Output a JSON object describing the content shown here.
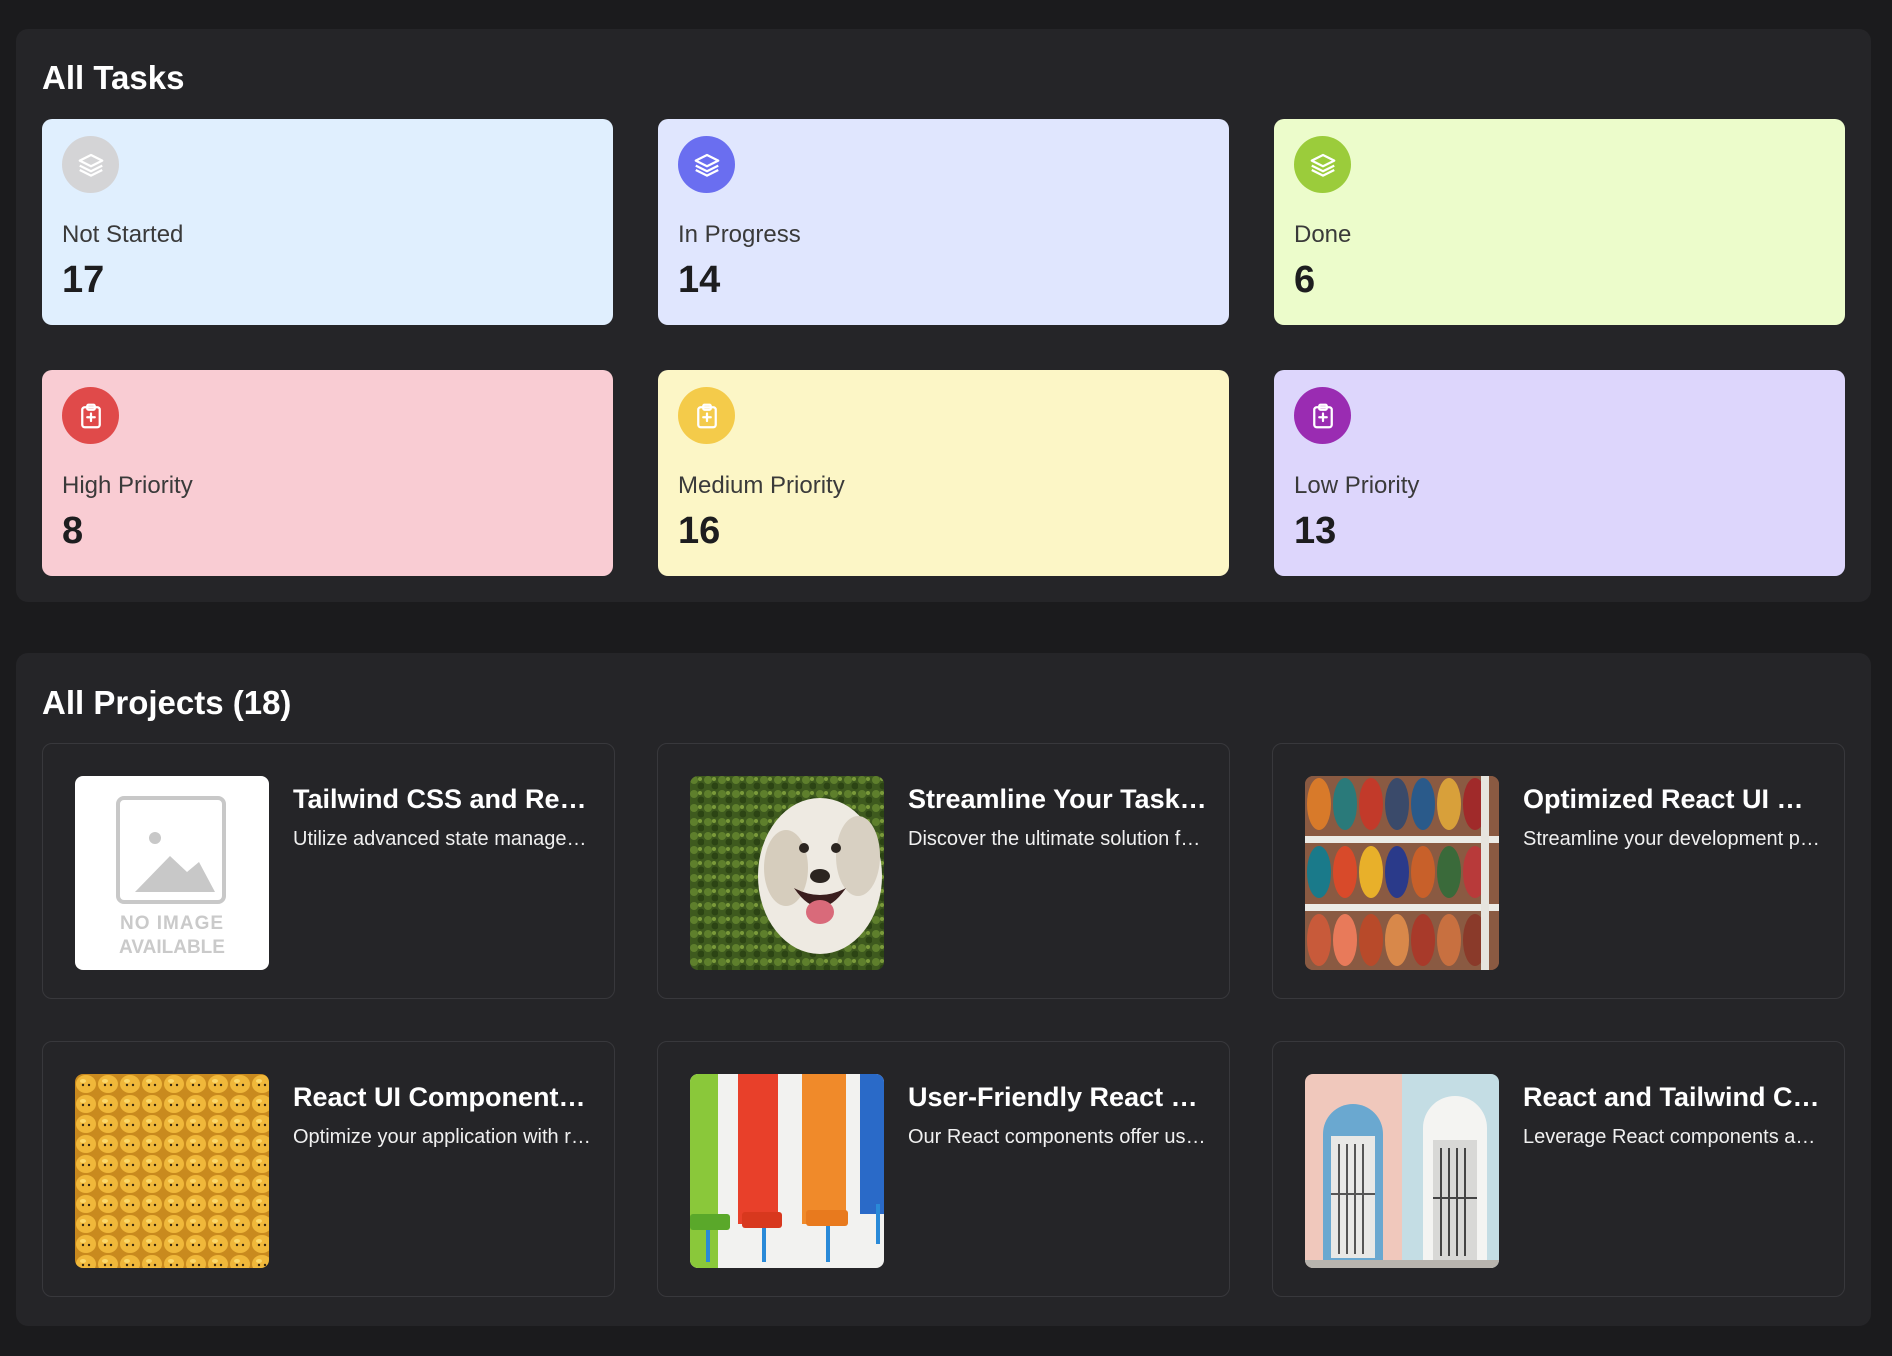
{
  "tasks_section": {
    "title": "All Tasks",
    "cards": [
      {
        "label": "Not Started",
        "value": "17",
        "icon": "layers-icon",
        "bg": "#e0effe",
        "icon_bg": "#d4d4d6"
      },
      {
        "label": "In Progress",
        "value": "14",
        "icon": "layers-icon",
        "bg": "#e0e6fe",
        "icon_bg": "#6a6ef0"
      },
      {
        "label": "Done",
        "value": "6",
        "icon": "layers-icon",
        "bg": "#ecfccb",
        "icon_bg": "#9bcc3b"
      },
      {
        "label": "High Priority",
        "value": "8",
        "icon": "clipboard-plus-icon",
        "bg": "#f9ccd3",
        "icon_bg": "#e04a4a"
      },
      {
        "label": "Medium Priority",
        "value": "16",
        "icon": "clipboard-plus-icon",
        "bg": "#fcf6c6",
        "icon_bg": "#f4cb4a"
      },
      {
        "label": "Low Priority",
        "value": "13",
        "icon": "clipboard-plus-icon",
        "bg": "#ddd6fc",
        "icon_bg": "#9a2cb2"
      }
    ]
  },
  "projects_section": {
    "title": "All Projects (18)",
    "projects": [
      {
        "title": "Tailwind CSS and React UI Components",
        "description": "Utilize advanced state management techniques",
        "image": "no-image-placeholder",
        "placeholder_text": [
          "NO IMAGE",
          "AVAILABLE"
        ]
      },
      {
        "title": "Streamline Your Tasks with React",
        "description": "Discover the ultimate solution for your projects",
        "image": "dog-photo"
      },
      {
        "title": "Optimized React UI Components",
        "description": "Streamline your development process with ease",
        "image": "shoes-photo"
      },
      {
        "title": "React UI Components Library",
        "description": "Optimize your application with ready-made parts",
        "image": "lego-heads-photo"
      },
      {
        "title": "User-Friendly React Components",
        "description": "Our React components offer usability at scale",
        "image": "paint-rollers-photo"
      },
      {
        "title": "React and Tailwind CSS Kit",
        "description": "Leverage React components and Tailwind utilities",
        "image": "doors-photo"
      }
    ]
  }
}
